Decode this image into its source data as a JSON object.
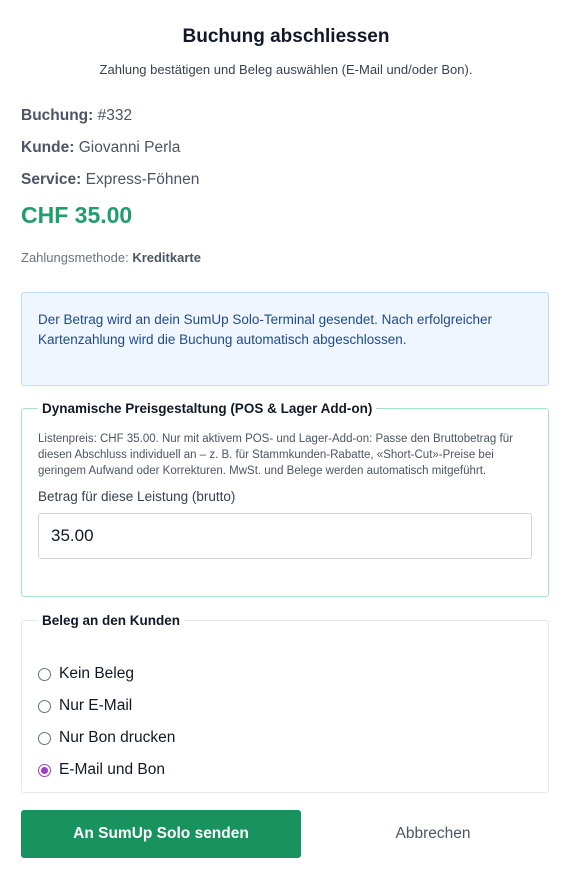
{
  "header": {
    "title": "Buchung abschliessen",
    "subtitle": "Zahlung bestätigen und Beleg auswählen (E-Mail und/oder Bon)."
  },
  "booking": {
    "booking_label": "Buchung:",
    "booking_value": "#332",
    "customer_label": "Kunde:",
    "customer_value": "Giovanni Perla",
    "service_label": "Service:",
    "service_value": "Express-Föhnen",
    "price": "CHF 35.00",
    "price_color": "#1f9d6b",
    "payment_label": "Zahlungsmethode:",
    "payment_value": "Kreditkarte"
  },
  "notice": {
    "text": "Der Betrag wird an dein SumUp Solo-Terminal gesendet. Nach erfolgreicher Kartenzahlung wird die Buchung automatisch abgeschlossen."
  },
  "pricing": {
    "legend": "Dynamische Preisgestaltung (POS & Lager Add-on)",
    "description": "Listenpreis: CHF 35.00. Nur mit aktivem POS- und Lager-Add-on: Passe den Bruttobetrag für diesen Abschluss individuell an – z. B. für Stammkunden-Rabatte, «Short-Cut»-Preise bei geringem Aufwand oder Korrekturen. MwSt. und Belege werden automatisch mitgeführt.",
    "amount_label": "Betrag für diese Leistung (brutto)",
    "amount_value": "35.00"
  },
  "receipt": {
    "legend": "Beleg an den Kunden",
    "options": [
      {
        "label": "Kein Beleg",
        "selected": false
      },
      {
        "label": "Nur E-Mail",
        "selected": false
      },
      {
        "label": "Nur Bon drucken",
        "selected": false
      },
      {
        "label": "E-Mail und Bon",
        "selected": true
      }
    ],
    "accent_color": "#9b3fc4"
  },
  "actions": {
    "submit_label": "An SumUp Solo senden",
    "submit_color": "#18935f",
    "cancel_label": "Abbrechen"
  }
}
